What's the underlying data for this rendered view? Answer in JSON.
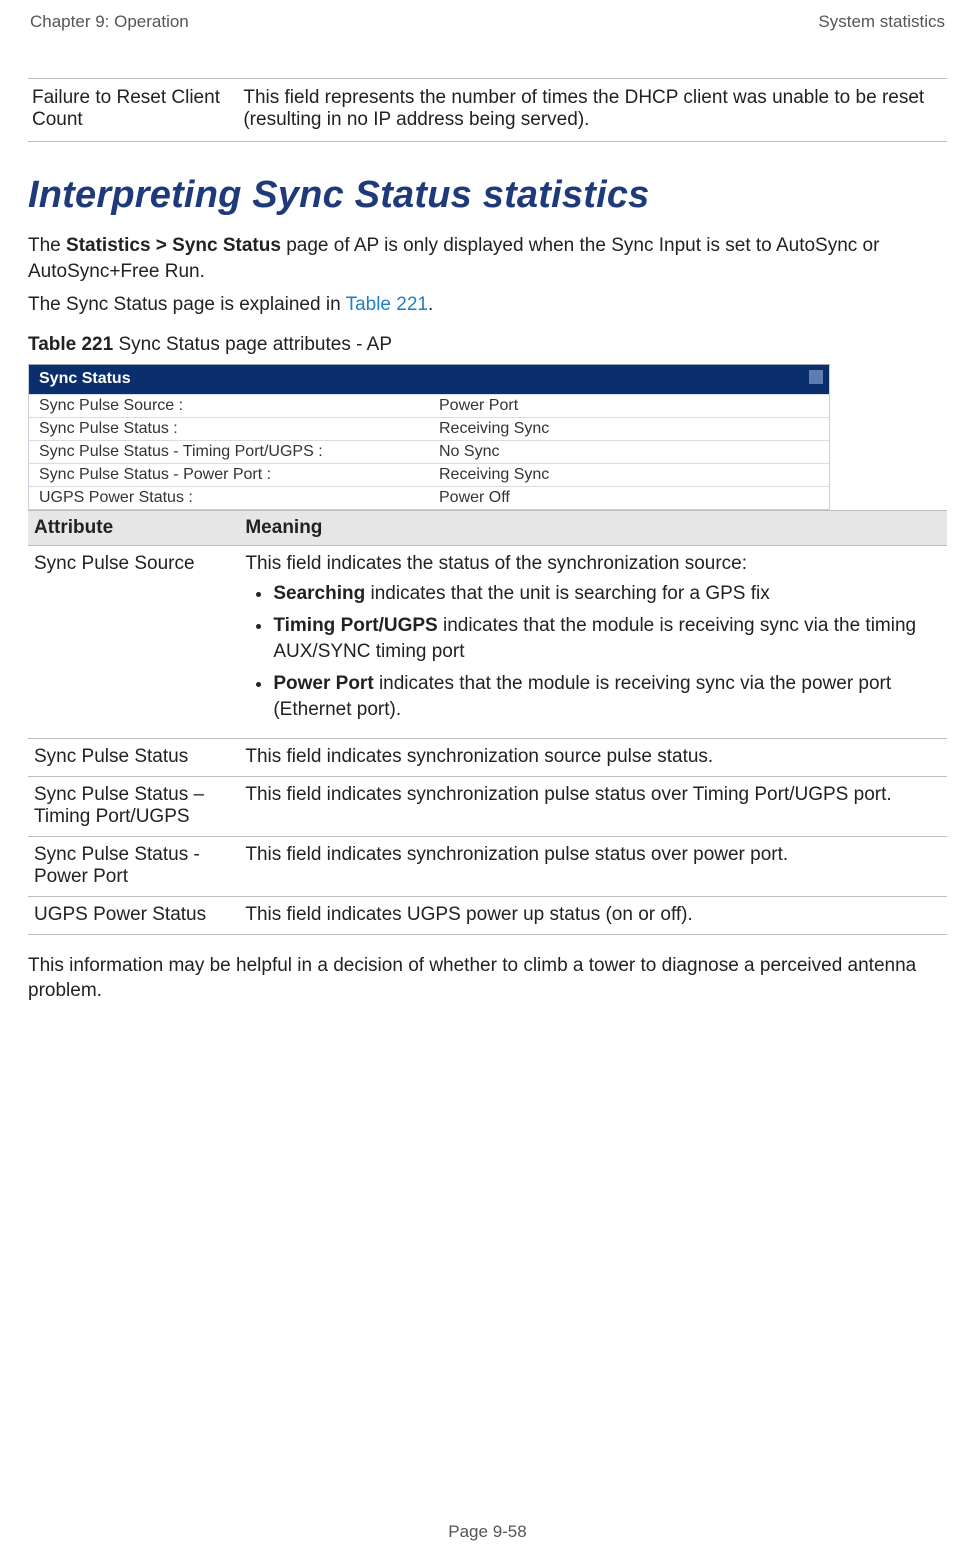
{
  "header": {
    "left": "Chapter 9:  Operation",
    "right": "System statistics"
  },
  "prev_table_row": {
    "attribute": "Failure to Reset Client Count",
    "meaning": "This field represents the number of times the DHCP client was unable to be reset (resulting in no IP address being served)."
  },
  "section_heading": "Interpreting Sync Status statistics",
  "para_1a": "The ",
  "para_1b_bold": "Statistics > Sync Status",
  "para_1c": " page of AP is only displayed when the Sync Input is set to AutoSync or AutoSync+Free Run.",
  "para_2a": "The Sync Status page is explained in ",
  "para_2_link": "Table 221",
  "para_2b": ".",
  "table_caption_bold": "Table 221 ",
  "table_caption_rest": "Sync Status page attributes - AP",
  "screenshot": {
    "title": "Sync Status",
    "rows": [
      {
        "label": "Sync Pulse Source :",
        "value": "Power Port"
      },
      {
        "label": "Sync Pulse Status :",
        "value": "Receiving Sync"
      },
      {
        "label": "Sync Pulse Status - Timing Port/UGPS :",
        "value": "No Sync"
      },
      {
        "label": "Sync Pulse Status - Power Port :",
        "value": "Receiving Sync"
      },
      {
        "label": "UGPS Power Status :",
        "value": "Power Off"
      }
    ]
  },
  "attr_table": {
    "header_attr": "Attribute",
    "header_mean": "Meaning",
    "row0": {
      "attr": "Sync Pulse Source",
      "intro": "This field indicates the status of the synchronization source:",
      "b0_bold": "Searching",
      "b0_rest": " indicates that the unit is searching for a GPS fix",
      "b1_bold": "Timing Port/UGPS",
      "b1_rest": " indicates that the module is receiving sync via the timing AUX/SYNC timing port",
      "b2_bold": "Power Port",
      "b2_rest": " indicates that the module is receiving sync via the power port (Ethernet port)."
    },
    "row1": {
      "attr": "Sync Pulse Status",
      "mean": "This field indicates synchronization source pulse status."
    },
    "row2": {
      "attr": "Sync Pulse Status – Timing Port/UGPS",
      "mean": "This field indicates synchronization pulse status over Timing Port/UGPS port."
    },
    "row3": {
      "attr": "Sync Pulse Status - Power Port",
      "mean": "This field indicates synchronization pulse status over power port."
    },
    "row4": {
      "attr": "UGPS Power Status",
      "mean": "This field indicates UGPS power up status (on or off)."
    }
  },
  "closing_para": "This information may be helpful in a decision of whether to climb a tower to diagnose a perceived antenna problem.",
  "footer_page": "Page 9-58"
}
